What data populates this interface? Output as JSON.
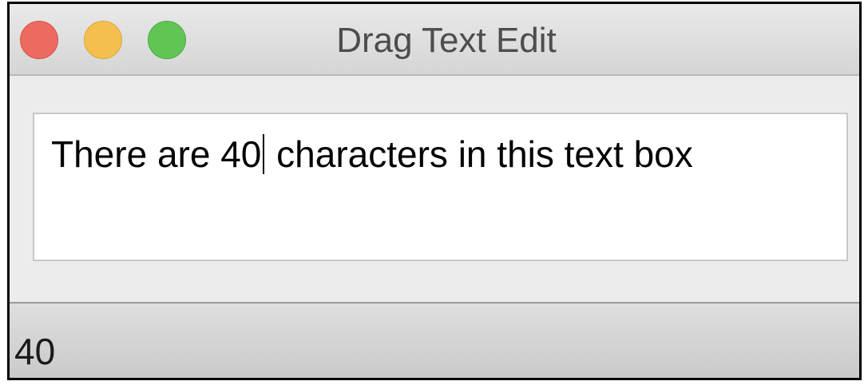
{
  "window": {
    "title": "Drag Text Edit",
    "controls": [
      {
        "name": "close",
        "icon": "close-icon",
        "color": "#ed6a5e"
      },
      {
        "name": "minimize",
        "icon": "minimize-icon",
        "color": "#f5bf4f"
      },
      {
        "name": "zoom",
        "icon": "zoom-icon",
        "color": "#61c554"
      }
    ]
  },
  "editor": {
    "text_before_caret": "There are 40",
    "text_after_caret": " characters in this text box"
  },
  "status": {
    "char_count": "40"
  }
}
